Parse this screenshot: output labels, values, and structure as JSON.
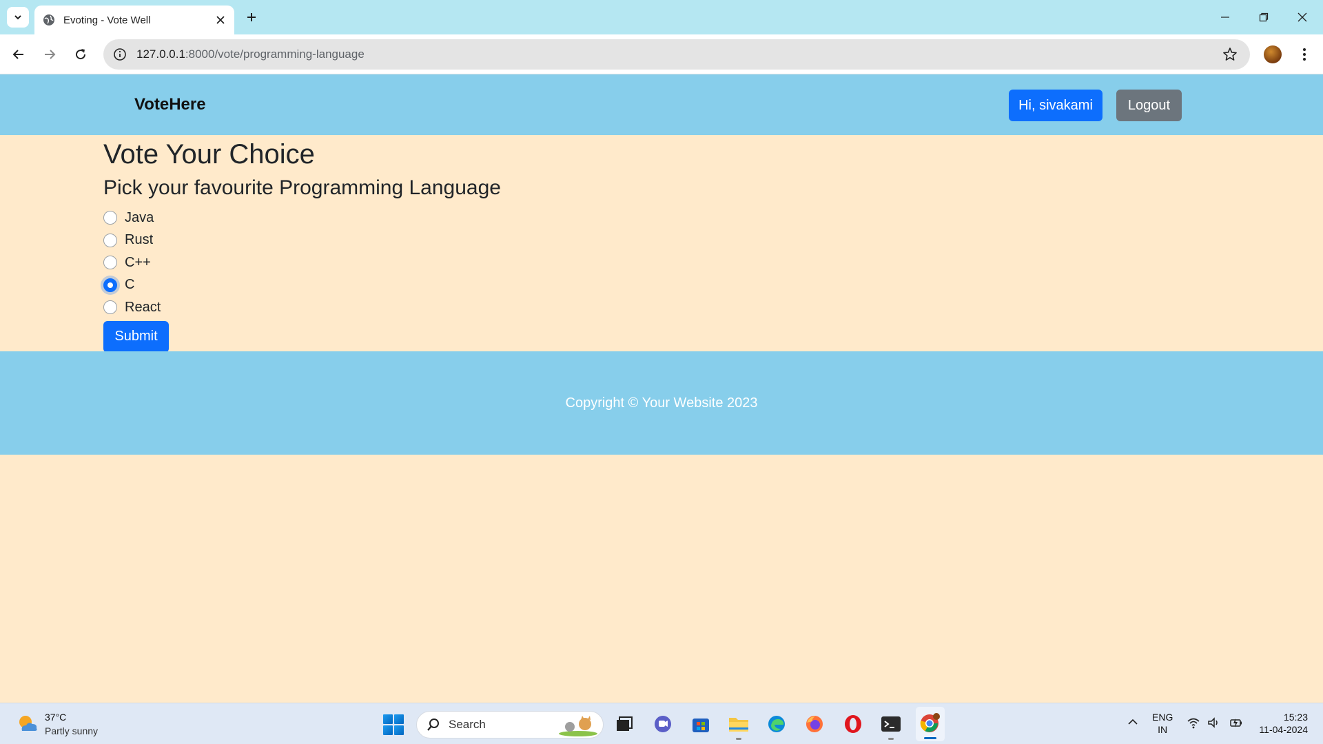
{
  "browser": {
    "tab_title": "Evoting - Vote Well",
    "url_host": "127.0.0.1",
    "url_rest": ":8000/vote/programming-language"
  },
  "site": {
    "brand": "VoteHere",
    "greeting": "Hi, sivakami",
    "logout": "Logout",
    "heading": "Vote Your Choice",
    "subheading": "Pick your favourite Programming Language",
    "options": [
      {
        "label": "Java",
        "checked": false
      },
      {
        "label": "Rust",
        "checked": false
      },
      {
        "label": "C++",
        "checked": false
      },
      {
        "label": "C",
        "checked": true
      },
      {
        "label": "React",
        "checked": false
      }
    ],
    "submit": "Submit",
    "footer": "Copyright © Your Website 2023"
  },
  "taskbar": {
    "temperature": "37°C",
    "weather": "Partly sunny",
    "search_label": "Search",
    "lang_1": "ENG",
    "lang_2": "IN",
    "time": "15:23",
    "date": "11-04-2024"
  }
}
